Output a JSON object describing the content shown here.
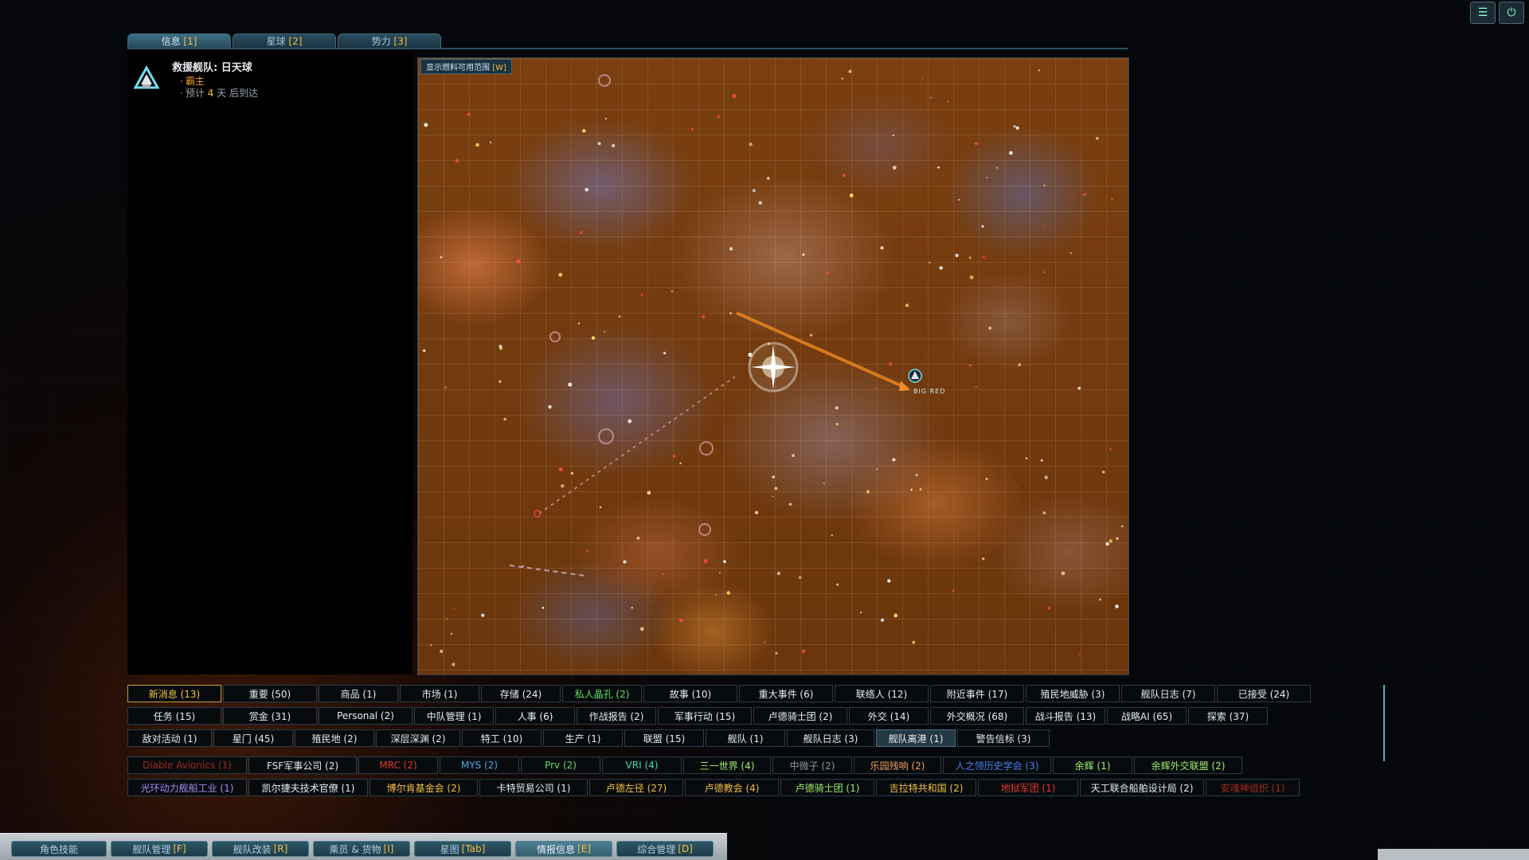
{
  "top_tabs": [
    {
      "label": "信息",
      "key": "[1]",
      "active": true
    },
    {
      "label": "星球",
      "key": "[2]"
    },
    {
      "label": "势力",
      "key": "[3]"
    }
  ],
  "notification": {
    "title": "救援舰队: 日天球",
    "faction": "霸主",
    "eta_prefix": "预计",
    "eta_days": "4",
    "eta_suffix": "天 后到达"
  },
  "map": {
    "fuel_toggle": "显示燃料可用范围",
    "fuel_key": "[W]",
    "fleet_label": "BIG RED",
    "colors": {
      "route": "#e08020",
      "trail": "#c09090",
      "nebula_base": "#7a3f10"
    }
  },
  "filter_rows": [
    [
      {
        "label": "新消息 (13)",
        "w": 118,
        "active": true
      },
      {
        "label": "重要 (50)",
        "w": 118
      },
      {
        "label": "商品 (1)",
        "w": 100
      },
      {
        "label": "市场 (1)",
        "w": 100
      },
      {
        "label": "存储 (24)",
        "w": 100
      },
      {
        "label": "私人晶孔 (2)",
        "w": 100,
        "color": "#5fe05f"
      },
      {
        "label": "故事 (10)",
        "w": 118
      },
      {
        "label": "重大事件 (6)",
        "w": 118
      },
      {
        "label": "联络人 (12)",
        "w": 118
      },
      {
        "label": "附近事件 (17)",
        "w": 118
      },
      {
        "label": "殖民地威胁 (3)",
        "w": 118
      },
      {
        "label": "舰队日志 (7)",
        "w": 118
      },
      {
        "label": "已接受 (24)",
        "w": 118
      }
    ],
    [
      {
        "label": "任务 (15)",
        "w": 118
      },
      {
        "label": "赏金 (31)",
        "w": 118
      },
      {
        "label": "Personal (2)",
        "w": 118
      },
      {
        "label": "中队管理 (1)",
        "w": 100
      },
      {
        "label": "人事 (6)",
        "w": 100
      },
      {
        "label": "作战报告 (2)",
        "w": 100
      },
      {
        "label": "军事行动 (15)",
        "w": 118
      },
      {
        "label": "卢德骑士团 (2)",
        "w": 118
      },
      {
        "label": "外交 (14)",
        "w": 100
      },
      {
        "label": "外交概况 (68)",
        "w": 118
      },
      {
        "label": "战斗报告 (13)",
        "w": 100
      },
      {
        "label": "战略AI (65)",
        "w": 100
      },
      {
        "label": "探索 (37)",
        "w": 100
      }
    ],
    [
      {
        "label": "敌对活动 (1)",
        "w": 106
      },
      {
        "label": "星门 (45)",
        "w": 100
      },
      {
        "label": "殖民地 (2)",
        "w": 100
      },
      {
        "label": "深层深渊 (2)",
        "w": 106
      },
      {
        "label": "特工 (10)",
        "w": 100
      },
      {
        "label": "生产 (1)",
        "w": 100
      },
      {
        "label": "联盟 (15)",
        "w": 100
      },
      {
        "label": "舰队 (1)",
        "w": 100
      },
      {
        "label": "舰队日志 (3)",
        "w": 110
      },
      {
        "label": "舰队离港 (1)",
        "w": 100,
        "sel": true
      },
      {
        "label": "警告信标 (3)",
        "w": 116
      }
    ],
    [
      {
        "label": "Diable Avionics (1)",
        "w": 150,
        "color": "#a02a1a"
      },
      {
        "label": "FSF军事公司 (2)",
        "w": 136
      },
      {
        "label": "MRC (2)",
        "w": 100,
        "color": "#e03a2a"
      },
      {
        "label": "MYS (2)",
        "w": 100,
        "color": "#4aa8e8"
      },
      {
        "label": "Prv (2)",
        "w": 100,
        "color": "#5fe05f"
      },
      {
        "label": "VRI (4)",
        "w": 100,
        "color": "#38e0b0"
      },
      {
        "label": "三一世界 (4)",
        "w": 110,
        "color": "#9ff06f"
      },
      {
        "label": "中微子 (2)",
        "w": 100,
        "color": "#8a96a0"
      },
      {
        "label": "乐园残响 (2)",
        "w": 110,
        "color": "#f0a060"
      },
      {
        "label": "人之领历史学会 (3)",
        "w": 136,
        "color": "#4a7ff0"
      },
      {
        "label": "余辉 (1)",
        "w": 100,
        "color": "#9ff06f"
      },
      {
        "label": "余辉外交联盟 (2)",
        "w": 136,
        "color": "#9ff06f"
      }
    ],
    [
      {
        "label": "光环动力舰船工业 (1)",
        "w": 150,
        "color": "#a48af0"
      },
      {
        "label": "凯尔捷夫技术官僚 (1)",
        "w": 150
      },
      {
        "label": "博尔肯基金会 (2)",
        "w": 136,
        "color": "#f0c040"
      },
      {
        "label": "卡特贸易公司 (1)",
        "w": 136
      },
      {
        "label": "卢德左径 (27)",
        "w": 118,
        "color": "#f0c040"
      },
      {
        "label": "卢德教会 (4)",
        "w": 118,
        "color": "#f0c040"
      },
      {
        "label": "卢德骑士团 (1)",
        "w": 118,
        "color": "#9ff06f"
      },
      {
        "label": "吉拉特共和国 (2)",
        "w": 126,
        "color": "#f0c040"
      },
      {
        "label": "地狱军团 (1)",
        "w": 126,
        "color": "#e03a2a"
      },
      {
        "label": "天工联合船舶设计局 (2)",
        "w": 156
      },
      {
        "label": "安魂神组织 (1)",
        "w": 118,
        "color": "#a02a1a"
      }
    ]
  ],
  "bottom_tabs": [
    {
      "label": "角色技能",
      "key": "",
      "w": 120
    },
    {
      "label": "舰队管理",
      "key": "[F]",
      "w": 122
    },
    {
      "label": "舰队改装",
      "key": "[R]",
      "w": 122
    },
    {
      "label": "乘员 & 货物",
      "key": "[I]",
      "w": 122
    },
    {
      "label": "星图",
      "key": "[Tab]",
      "w": 122
    },
    {
      "label": "情报信息",
      "key": "[E]",
      "w": 122,
      "active": true
    },
    {
      "label": "综合管理",
      "key": "[D]",
      "w": 122
    }
  ]
}
